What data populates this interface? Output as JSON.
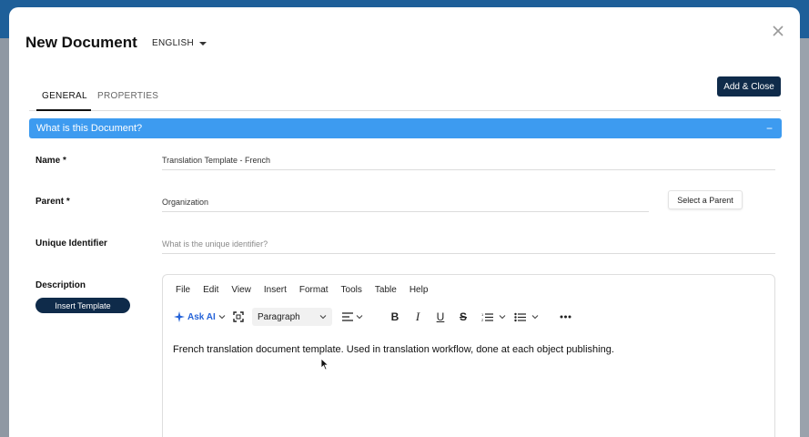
{
  "modal": {
    "title": "New Document",
    "language": "ENGLISH",
    "add_close_label": "Add & Close"
  },
  "tabs": [
    {
      "label": "GENERAL",
      "active": true
    },
    {
      "label": "PROPERTIES",
      "active": false
    }
  ],
  "section": {
    "title": "What is this Document?",
    "collapse_symbol": "−"
  },
  "form": {
    "name": {
      "label": "Name *",
      "value": "Translation Template - French"
    },
    "parent": {
      "label": "Parent  *",
      "value": "Organization",
      "button_label": "Select a Parent"
    },
    "unique_identifier": {
      "label": "Unique Identifier",
      "placeholder": "What is the unique identifier?"
    },
    "description": {
      "label": "Description",
      "insert_template_label": "Insert Template"
    }
  },
  "editor": {
    "menu": [
      "File",
      "Edit",
      "View",
      "Insert",
      "Format",
      "Tools",
      "Table",
      "Help"
    ],
    "ask_ai_label": "Ask AI",
    "block_format": "Paragraph",
    "content": "French translation document template. Used in translation workflow, done at each object publishing."
  },
  "colors": {
    "primary_dark": "#0f2b4a",
    "section_blue": "#3d9bf0",
    "ai_blue": "#2563d8",
    "top_bar": "#1e5f99"
  }
}
